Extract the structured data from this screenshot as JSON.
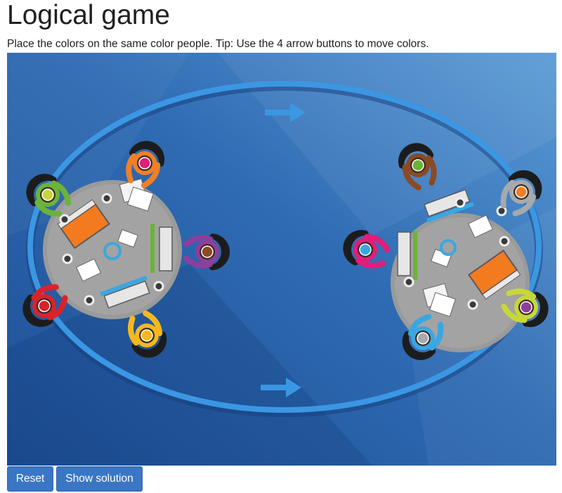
{
  "page": {
    "title": "Logical game",
    "instructions": "Place the colors on the same color people. Tip: Use the 4 arrow buttons to move colors."
  },
  "buttons": {
    "reset_label": "Reset",
    "solution_label": "Show solution"
  },
  "board": {
    "background": [
      "#1e4f96",
      "#5b9bd6"
    ],
    "track_color": "#3b97e3",
    "arrows": [
      "right",
      "right"
    ],
    "left_table": {
      "seats": [
        {
          "person": "orange",
          "token": "magenta"
        },
        {
          "person": "purple",
          "token": "brown"
        },
        {
          "person": "yellow",
          "token": "yellow"
        },
        {
          "person": "red",
          "token": "red"
        },
        {
          "person": "green",
          "token": "lime"
        }
      ]
    },
    "right_table": {
      "seats": [
        {
          "person": "brown",
          "token": "green"
        },
        {
          "person": "grey",
          "token": "orange"
        },
        {
          "person": "lime",
          "token": "purple"
        },
        {
          "person": "blue",
          "token": "grey"
        },
        {
          "person": "magenta",
          "token": "blue"
        }
      ]
    }
  },
  "colors": {
    "orange": "#f07f26",
    "magenta": "#e21d7a",
    "purple": "#8e3f9b",
    "brown": "#8a4a24",
    "yellow": "#f6b81c",
    "red": "#d8232a",
    "green": "#6bb339",
    "lime": "#c7d73a",
    "grey": "#a7a9ac",
    "blue": "#3aa7e0"
  }
}
